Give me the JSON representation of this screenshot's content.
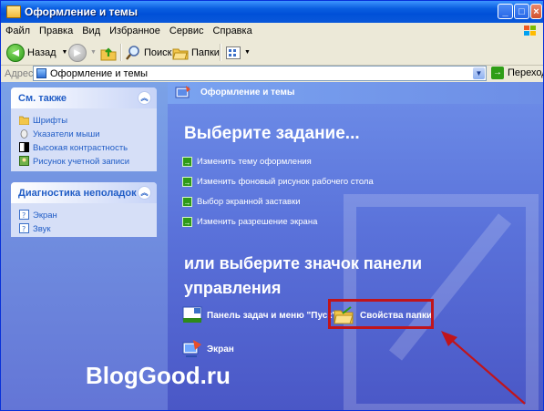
{
  "window": {
    "title": "Оформление и темы"
  },
  "menu": [
    "Файл",
    "Правка",
    "Вид",
    "Избранное",
    "Сервис",
    "Справка"
  ],
  "toolbar": {
    "back_label": "Назад",
    "search_label": "Поиск",
    "folders_label": "Папки"
  },
  "address": {
    "label": "Адрес:",
    "value": "Оформление и темы",
    "go_label": "Переход"
  },
  "sidebar": {
    "see_also": {
      "title": "См. также",
      "items": [
        {
          "label": "Шрифты",
          "icon": "fonts-folder-icon"
        },
        {
          "label": "Указатели мыши",
          "icon": "mouse-pointer-icon"
        },
        {
          "label": "Высокая контрастность",
          "icon": "contrast-icon"
        },
        {
          "label": "Рисунок учетной записи",
          "icon": "user-picture-icon"
        }
      ]
    },
    "troubleshoot": {
      "title": "Диагностика неполадок",
      "items": [
        {
          "label": "Экран",
          "icon": "help-icon"
        },
        {
          "label": "Звук",
          "icon": "help-icon"
        }
      ]
    }
  },
  "main": {
    "header": "Оформление и темы",
    "pick_task": "Выберите задание...",
    "tasks": [
      "Изменить тему оформления",
      "Изменить фоновый рисунок рабочего стола",
      "Выбор экранной заставки",
      "Изменить разрешение экрана"
    ],
    "pick_icon": "или выберите значок панели управления",
    "icons": [
      {
        "label": "Панель задач и меню \"Пуск\"",
        "icon": "taskbar-icon"
      },
      {
        "label": "Свойства папки",
        "icon": "folder-options-icon"
      },
      {
        "label": "Экран",
        "icon": "display-icon"
      }
    ]
  },
  "watermark": "BlogGood.ru",
  "colors": {
    "highlight": "#c0141b",
    "arrow": "#c0141b",
    "link": "#215dc6"
  }
}
